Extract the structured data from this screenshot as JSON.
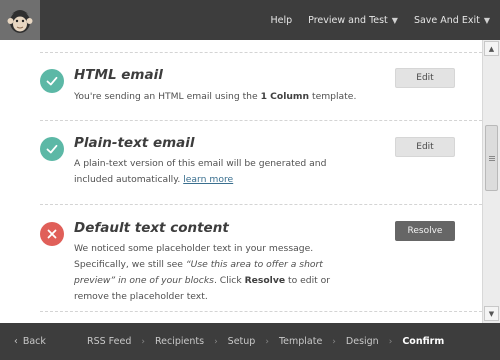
{
  "topbar": {
    "logo_icon": "chimp-logo",
    "nav": [
      {
        "label": "Help",
        "has_caret": false
      },
      {
        "label": "Preview and Test",
        "has_caret": true
      },
      {
        "label": "Save And Exit",
        "has_caret": true
      }
    ]
  },
  "sections": [
    {
      "status": "ok",
      "status_icon": "check-icon",
      "title": "HTML email",
      "desc_parts": [
        "You're sending an HTML email using the ",
        "1 Column",
        " template."
      ],
      "button": "Edit"
    },
    {
      "status": "ok",
      "status_icon": "check-icon",
      "title": "Plain-text email",
      "desc_parts": [
        "A plain-text version of this email will be generated and included automatically. ",
        "learn more"
      ],
      "button": "Edit"
    },
    {
      "status": "error",
      "status_icon": "x-icon",
      "title": "Default text content",
      "desc_parts": [
        "We noticed some placeholder text in your message. Specifically, we still see ",
        "“Use this area to offer a short preview” in one of your blocks",
        ". Click ",
        "Resolve",
        " to edit or remove the placeholder text."
      ],
      "button": "Resolve"
    }
  ],
  "bottombar": {
    "back_label": "Back",
    "steps": [
      "RSS Feed",
      "Recipients",
      "Setup",
      "Template",
      "Design",
      "Confirm"
    ],
    "current_step": "Confirm"
  },
  "colors": {
    "bar_bg": "#3d3d3d",
    "ok": "#5cb8a6",
    "error": "#e05f59",
    "resolve_button": "#666666"
  }
}
